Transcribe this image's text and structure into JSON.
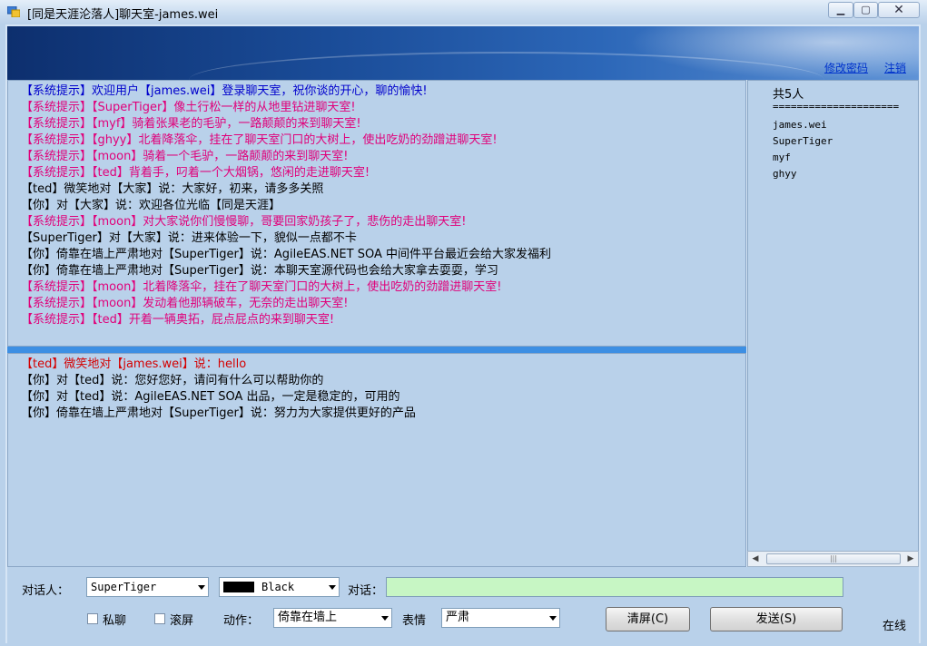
{
  "window": {
    "title": "[同是天涯沦落人]聊天室-james.wei",
    "minimize": "▁",
    "maximize": "▢",
    "close": "✕"
  },
  "header": {
    "change_password": "修改密码",
    "logout": "注销"
  },
  "public_messages": [
    {
      "text": "【系统提示】欢迎用户【james.wei】登录聊天室，祝你谈的开心，聊的愉快!",
      "color": "#0000cc"
    },
    {
      "text": "【系统提示】【SuperTiger】像土行松一样的从地里钻进聊天室!",
      "color": "#e0007a"
    },
    {
      "text": "【系统提示】【myf】骑着张果老的毛驴，一路颠颠的来到聊天室!",
      "color": "#e0007a"
    },
    {
      "text": "【系统提示】【ghyy】北着降落伞，挂在了聊天室门口的大树上，使出吃奶的劲蹭进聊天室!",
      "color": "#e0007a"
    },
    {
      "text": "【系统提示】【moon】骑着一个毛驴，一路颠颠的来到聊天室!",
      "color": "#e0007a"
    },
    {
      "text": "【系统提示】【ted】背着手，叼着一个大烟锅，悠闲的走进聊天室!",
      "color": "#e0007a"
    },
    {
      "text": "【ted】微笑地对【大家】说：大家好，初来，请多多关照",
      "color": "#000000"
    },
    {
      "text": "【你】对【大家】说：欢迎各位光临【同是天涯】",
      "color": "#000000"
    },
    {
      "text": "【系统提示】【moon】对大家说你们慢慢聊，哥要回家奶孩子了，悲伤的走出聊天室!",
      "color": "#e0007a"
    },
    {
      "text": "【SuperTiger】对【大家】说：进来体验一下，貌似一点都不卡",
      "color": "#000000"
    },
    {
      "text": "【你】倚靠在墙上严肃地对【SuperTiger】说：AgileEAS.NET SOA 中间件平台最近会给大家发福利",
      "color": "#000000"
    },
    {
      "text": "【你】倚靠在墙上严肃地对【SuperTiger】说：本聊天室源代码也会给大家拿去耍耍，学习",
      "color": "#000000"
    },
    {
      "text": "【系统提示】【moon】北着降落伞，挂在了聊天室门口的大树上，使出吃奶的劲蹭进聊天室!",
      "color": "#e0007a"
    },
    {
      "text": "【系统提示】【moon】发动着他那辆破车，无奈的走出聊天室!",
      "color": "#e0007a"
    },
    {
      "text": "【系统提示】【ted】开着一辆奥拓，屁点屁点的来到聊天室!",
      "color": "#e0007a"
    }
  ],
  "private_messages": [
    {
      "text": "【ted】微笑地对【james.wei】说：hello",
      "color": "#d40000"
    },
    {
      "text": "【你】对【ted】说：您好您好，请问有什么可以帮助你的",
      "color": "#000000"
    },
    {
      "text": "【你】对【ted】说：AgileEAS.NET SOA 出品，一定是稳定的，可用的",
      "color": "#000000"
    },
    {
      "text": "【你】倚靠在墙上严肃地对【SuperTiger】说：努力为大家提供更好的产品",
      "color": "#000000"
    }
  ],
  "users": {
    "count_label": "共5人",
    "separator": "=====================",
    "list": [
      "james.wei",
      "SuperTiger",
      "myf",
      "ghyy"
    ]
  },
  "scrollbar": {
    "left": "◀",
    "right": "▶",
    "grip": "|||"
  },
  "controls": {
    "target_label": "对话人：",
    "target_value": "SuperTiger",
    "color_value": "Black",
    "chat_label": "对话：",
    "chat_value": "",
    "private_label": "私聊",
    "scroll_label": "滚屏",
    "action_label": "动作：",
    "action_value": "倚靠在墙上",
    "expression_label": "表情",
    "expression_value": "严肃",
    "clear_button": "清屏(C)",
    "send_button": "发送(S)",
    "status": "在线"
  }
}
